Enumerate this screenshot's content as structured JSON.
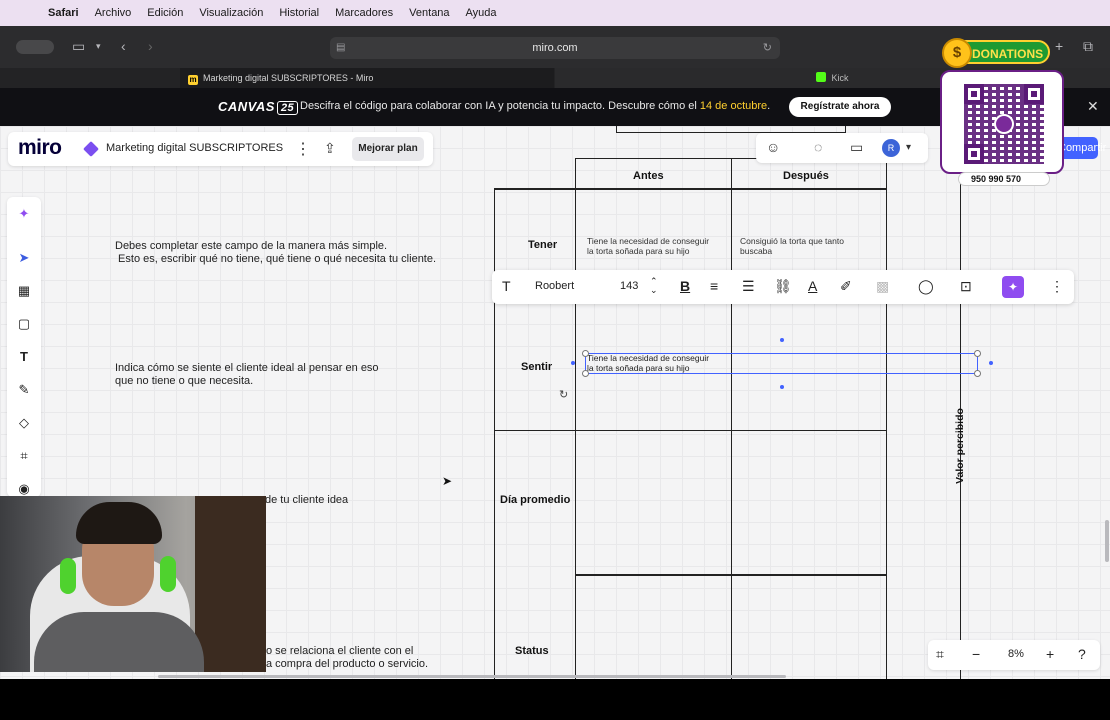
{
  "menubar": {
    "app": "Safari",
    "items": [
      "Archivo",
      "Edición",
      "Visualización",
      "Historial",
      "Marcadores",
      "Ventana",
      "Ayuda"
    ]
  },
  "browser": {
    "url": "miro.com",
    "tabs": [
      {
        "label": "Marketing digital SUBSCRIPTORES - Miro"
      },
      {
        "label": "Kick"
      }
    ]
  },
  "banner": {
    "logo": "CANVAS",
    "logo_num": "25",
    "message_pre": "Descifra el código para colaborar con IA y potencia tu impacto. Descubre cómo el ",
    "message_date": "14 de octubre",
    "message_post": ".",
    "cta": "Regístrate ahora",
    "close": "✕"
  },
  "miro": {
    "logo": "miro",
    "board_name": "Marketing digital SUBSCRIPTORES",
    "upgrade": "Mejorar plan",
    "share": "Compartir",
    "avatar": "R"
  },
  "board": {
    "columns": [
      "Antes",
      "Después"
    ],
    "rows": [
      "Tener",
      "Sentir",
      "Día promedio",
      "Status"
    ],
    "side_label": "Valor percibido",
    "instructions": [
      "Debes completar este campo de la manera más simple.\n Esto es, escribir qué no tiene, qué tiene o qué necesita tu cliente.",
      "Indica cómo se siente el cliente ideal al pensar en eso\nque no tiene o que necesita.",
      "Día promedio de tu cliente idea",
      "Cómo se relaciona el cliente con el\nla compra del producto o servicio."
    ],
    "instruction_visible": [
      "Debes completar este campo de la manera más simple.\n Esto es, escribir qué no tiene, qué tiene o qué necesita tu cliente.",
      "Indica cómo se siente el cliente ideal al pensar en eso\nque no tiene o que necesita.",
      "de tu cliente idea",
      "o se relaciona el cliente con el\na compra del producto o servicio."
    ],
    "cells": {
      "tener_antes": "Tiene la necesidad de conseguir\nla torta soñada para su hijo",
      "tener_despues": "Consiguió la torta que tanto\nbuscaba",
      "sentir_selected": "Tiene la necesidad de conseguir\nla torta soñada para su hijo"
    }
  },
  "format_toolbar": {
    "font": "Roobert",
    "size": "143"
  },
  "zoom": {
    "value": "8%"
  },
  "overlay": {
    "donations": "DONATIONS",
    "phone": "950 990 570"
  },
  "colors": {
    "accent": "#4262ff",
    "ai": "#8f4cf0",
    "banner_highlight": "#ffd02f"
  }
}
